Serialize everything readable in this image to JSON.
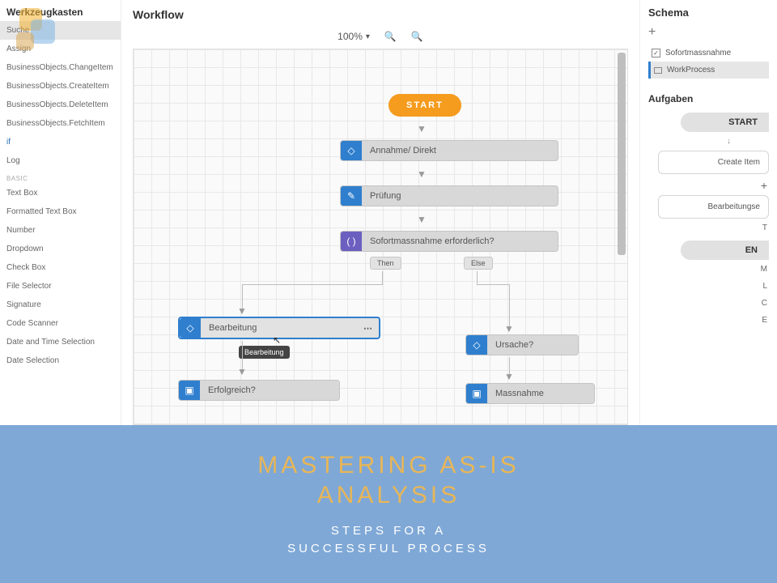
{
  "sidebar": {
    "title": "Werkzeugkasten",
    "selected": "Suche",
    "items_top": [
      "Assign",
      "BusinessObjects.ChangeItem",
      "BusinessObjects.CreateItem",
      "BusinessObjects.DeleteItem",
      "BusinessObjects.FetchItem"
    ],
    "link_if": "if",
    "log": "Log",
    "section_basic": "BASIC",
    "items_basic": [
      "Text Box",
      "Formatted Text Box",
      "Number",
      "Dropdown",
      "Check Box",
      "File Selector",
      "Signature",
      "Code Scanner",
      "Date and Time Selection",
      "Date Selection"
    ]
  },
  "center": {
    "title": "Workflow",
    "zoom": "100%"
  },
  "workflow": {
    "start": "START",
    "node_annahme": "Annahme/ Direkt",
    "node_pruefung": "Prüfung",
    "node_decision": "Sofortmassnahme erforderlich?",
    "branch_then": "Then",
    "branch_else": "Else",
    "node_bearbeitung": "Bearbeitung",
    "tooltip_bearbeitung": "Bearbeitung",
    "node_ursache": "Ursache?",
    "node_erfolgreich": "Erfolgreich?",
    "node_massnahme": "Massnahme"
  },
  "panel": {
    "title": "Schema",
    "item1": "Sofortmassnahme",
    "item2": "WorkProcess",
    "section_tasks": "Aufgaben",
    "task_start": "START",
    "task_create": "Create Item",
    "task_edit": "Bearbeitungse",
    "trail_t": "T",
    "task_end": "EN",
    "trail_m": "M",
    "trail_l": "L",
    "trail_c": "C",
    "trail_e": "E"
  },
  "banner": {
    "headline_l1": "MASTERING AS-IS",
    "headline_l2": "ANALYSIS",
    "sub_l1": "STEPS FOR A",
    "sub_l2": "SUCCESSFUL PROCESS"
  }
}
